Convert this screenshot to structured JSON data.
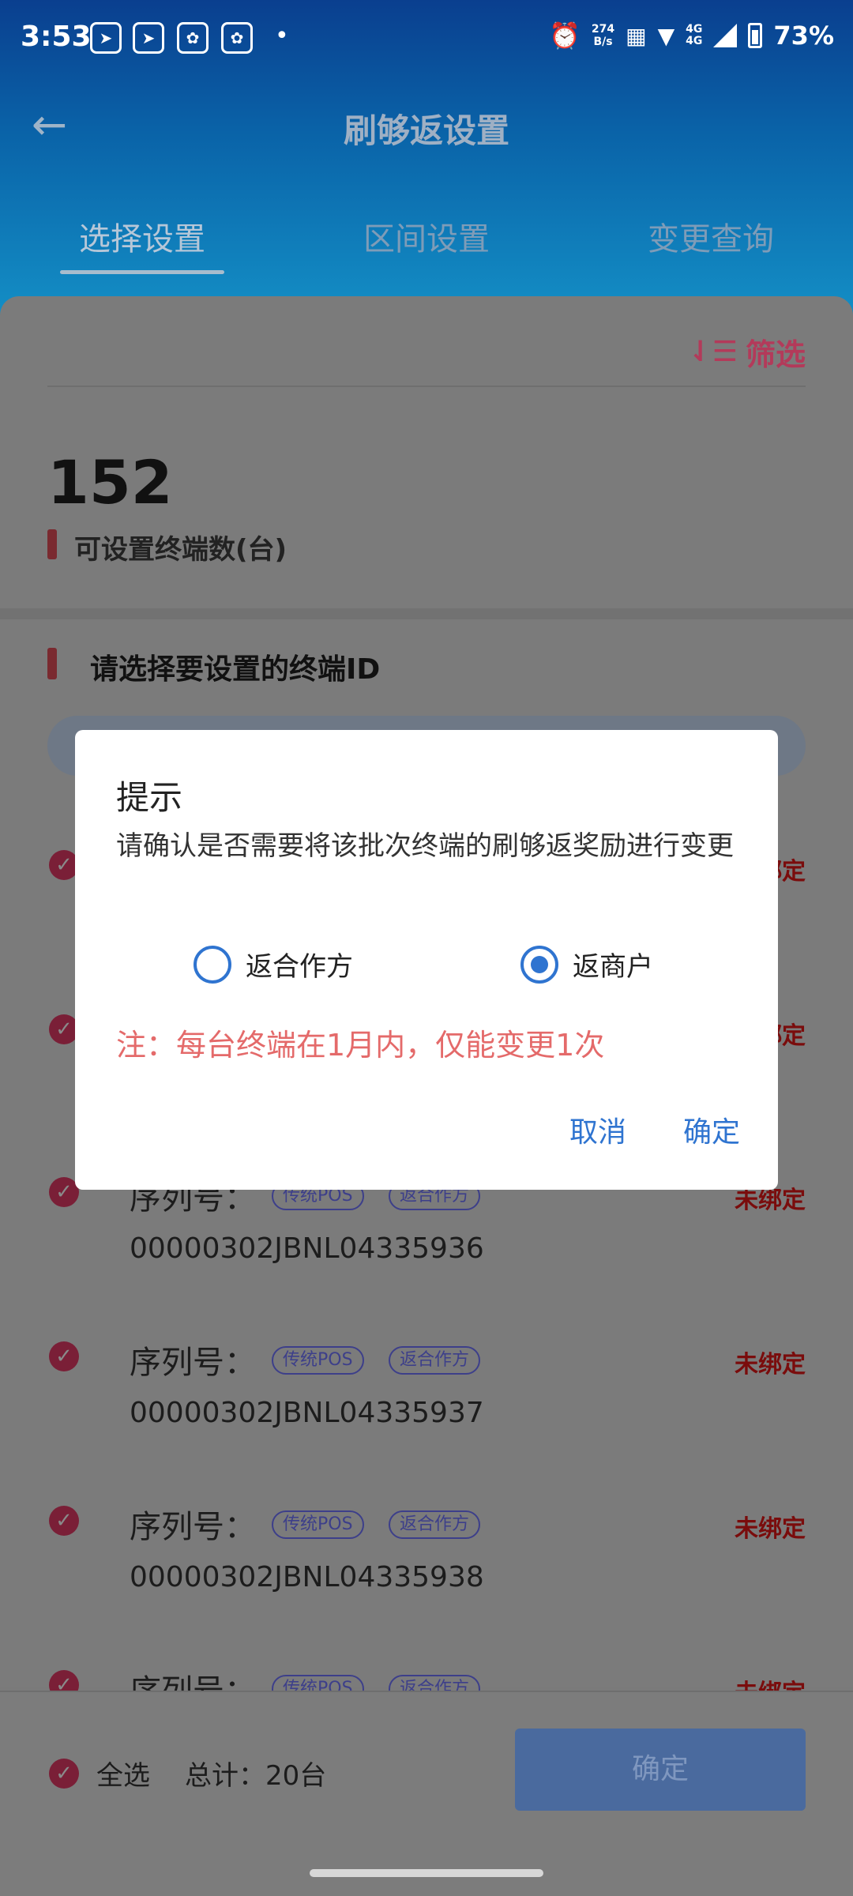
{
  "status_bar": {
    "time": "3:53",
    "net_speed_value": "274",
    "net_speed_unit": "B/s",
    "network": "4G",
    "battery": "73%"
  },
  "header": {
    "title": "刷够返设置",
    "tabs": [
      {
        "label": "选择设置",
        "active": true
      },
      {
        "label": "区间设置",
        "active": false
      },
      {
        "label": "变更查询",
        "active": false
      }
    ]
  },
  "filter": {
    "label": "筛选"
  },
  "summary": {
    "count": "152",
    "count_label": "可设置终端数(台)"
  },
  "section": {
    "title": "请选择要设置的终端ID"
  },
  "list": {
    "items": [
      {
        "sn_label": "序列号：",
        "badges": [
          "传统POS",
          "返合作方"
        ],
        "status": "未绑定",
        "sn": "00000302JBNL04335936"
      },
      {
        "sn_label": "序列号：",
        "badges": [
          "传统POS",
          "返合作方"
        ],
        "status": "未绑定",
        "sn": "00000302JBNL04335937"
      },
      {
        "sn_label": "序列号：",
        "badges": [
          "传统POS",
          "返合作方"
        ],
        "status": "未绑定",
        "sn": "00000302JBNL04335938"
      },
      {
        "sn_label": "序列号：",
        "badges": [
          "传统POS",
          "返合作方"
        ],
        "status": "未绑定",
        "sn": ""
      }
    ],
    "hidden_status": [
      "绑定",
      "绑定"
    ]
  },
  "bottom_bar": {
    "select_all": "全选",
    "total": "总计：20台",
    "confirm": "确定"
  },
  "dialog": {
    "title": "提示",
    "message": "请确认是否需要将该批次终端的刷够返奖励进行变更",
    "options": [
      {
        "label": "返合作方",
        "checked": false
      },
      {
        "label": "返商户",
        "checked": true
      }
    ],
    "note": "注：每台终端在1月内，仅能变更1次",
    "cancel": "取消",
    "ok": "确定"
  }
}
